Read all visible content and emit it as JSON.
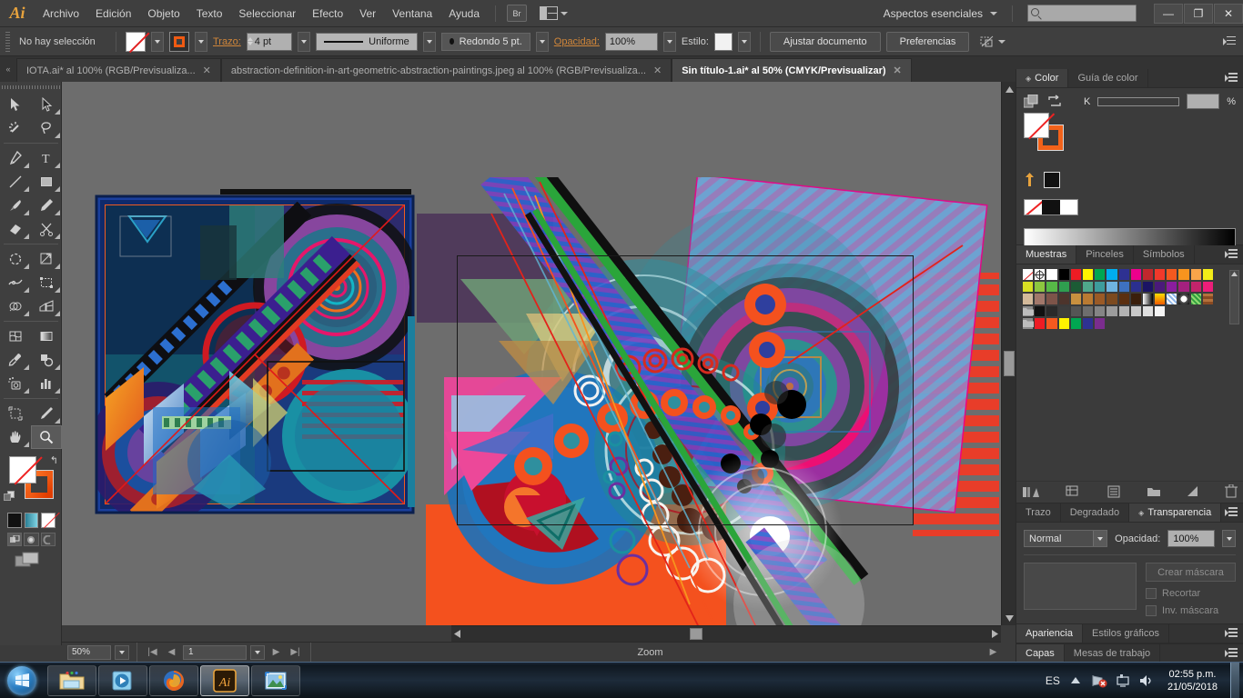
{
  "app": {
    "name": "Adobe Illustrator",
    "logo": "Ai"
  },
  "menubar": {
    "items": [
      "Archivo",
      "Edición",
      "Objeto",
      "Texto",
      "Seleccionar",
      "Efecto",
      "Ver",
      "Ventana",
      "Ayuda"
    ],
    "bridge_label": "Br",
    "workspace": "Aspectos esenciales",
    "search_placeholder": "",
    "minimize": "—",
    "restore": "❐",
    "close": "✕"
  },
  "controlbar": {
    "selection_status": "No hay selección",
    "stroke_label": "Trazo:",
    "stroke_weight": "4 pt",
    "stroke_profile": "Uniforme",
    "brush_definition": "Redondo 5 pt.",
    "opacity_label": "Opacidad:",
    "opacity_value": "100%",
    "style_label": "Estilo:",
    "fit_document_button": "Ajustar documento",
    "preferences_button": "Preferencias"
  },
  "tabs": [
    {
      "title": "IOTA.ai* al 100% (RGB/Previsualiza...",
      "active": false,
      "close": "✕"
    },
    {
      "title": "abstraction-definition-in-art-geometric-abstraction-paintings.jpeg al 100% (RGB/Previsualiza...",
      "active": false,
      "close": "✕"
    },
    {
      "title": "Sin título-1.ai* al 50% (CMYK/Previsualizar)",
      "active": true,
      "close": "✕"
    }
  ],
  "tools": {
    "rows": [
      [
        {
          "name": "selection-tool",
          "label": "Selección"
        },
        {
          "name": "direct-selection-tool",
          "label": "Selección directa"
        }
      ],
      [
        {
          "name": "magic-wand-tool",
          "label": "Varita mágica"
        },
        {
          "name": "lasso-tool",
          "label": "Lazo"
        }
      ],
      [
        {
          "name": "pen-tool",
          "label": "Pluma"
        },
        {
          "name": "type-tool",
          "label": "Texto"
        }
      ],
      [
        {
          "name": "line-segment-tool",
          "label": "Segmento de línea"
        },
        {
          "name": "rectangle-tool",
          "label": "Rectángulo"
        }
      ],
      [
        {
          "name": "paintbrush-tool",
          "label": "Pincel"
        },
        {
          "name": "pencil-tool",
          "label": "Lápiz"
        }
      ],
      [
        {
          "name": "blob-brush-tool",
          "label": "Pincel de manchas"
        },
        {
          "name": "eraser-tool",
          "label": "Borrador / Tijeras"
        }
      ],
      [
        {
          "name": "rotate-tool",
          "label": "Rotar"
        },
        {
          "name": "scale-tool",
          "label": "Escala"
        }
      ],
      [
        {
          "name": "width-tool",
          "label": "Anchura"
        },
        {
          "name": "free-transform-tool",
          "label": "Transformación libre"
        }
      ],
      [
        {
          "name": "shape-builder-tool",
          "label": "Creador de formas"
        },
        {
          "name": "perspective-grid-tool",
          "label": "Cuadrícula de perspectiva"
        }
      ],
      [
        {
          "name": "mesh-tool",
          "label": "Malla"
        },
        {
          "name": "gradient-tool",
          "label": "Degradado"
        }
      ],
      [
        {
          "name": "eyedropper-tool",
          "label": "Cuentagotas"
        },
        {
          "name": "blend-tool",
          "label": "Fusión"
        }
      ],
      [
        {
          "name": "symbol-sprayer-tool",
          "label": "Rociar símbolos"
        },
        {
          "name": "column-graph-tool",
          "label": "Gráfica de columnas"
        }
      ],
      [
        {
          "name": "artboard-tool",
          "label": "Mesa de trabajo"
        },
        {
          "name": "slice-tool",
          "label": "Sector"
        }
      ],
      [
        {
          "name": "hand-tool",
          "label": "Mano"
        },
        {
          "name": "zoom-tool",
          "label": "Zoom",
          "selected": true
        }
      ]
    ],
    "fill_stroke": {
      "fill": "none",
      "stroke": "#f2621a",
      "swap_label": "↰"
    },
    "color_modes": [
      "color-solid",
      "gradient",
      "none"
    ],
    "draw_modes": [
      "draw-normal",
      "draw-behind",
      "draw-inside"
    ]
  },
  "statusbar": {
    "zoom_level": "50%",
    "page_number": "1",
    "tool_status": "Zoom"
  },
  "dock": {
    "color_panel": {
      "tabs": [
        {
          "label": "Color",
          "active": true
        },
        {
          "label": "Guía de color",
          "active": false
        }
      ],
      "channel_label": "K",
      "channel_value": "",
      "percent_sign": "%"
    },
    "swatches_panel": {
      "tabs": [
        {
          "label": "Muestras",
          "active": true
        },
        {
          "label": "Pinceles",
          "active": false
        },
        {
          "label": "Símbolos",
          "active": false
        }
      ],
      "rows": [
        [
          "none",
          "registration",
          "#ffffff",
          "#000000",
          "#ed1c24",
          "#fff200",
          "#00a651",
          "#00aeef",
          "#2e3192",
          "#ec008c",
          "#c1272d",
          "#f1392b",
          "#f4591f",
          "#f7941e",
          "#f9a54a",
          "#f3ec18"
        ],
        [
          "#d7df23",
          "#8dc63f",
          "#57b947",
          "#2f9e4f",
          "#1c5b35",
          "#4fa88b",
          "#3d9c9c",
          "#6fb4e0",
          "#3e71c0",
          "#2b2f8f",
          "#1b1464",
          "#4a1a7a",
          "#8a1d9e",
          "#a4207f",
          "#c3246b",
          "#ec1e79"
        ],
        [
          "#d3b99a",
          "#a1776a",
          "#7d5449",
          "#4d342c",
          "#c9903f",
          "#b97a32",
          "#9a5a26",
          "#7c4a1f",
          "#5b2f10",
          "#3a1f0c",
          "grad-bw",
          "grad-orange",
          "pattern-blue",
          "pattern-ball",
          "pattern-green",
          "pattern-brick"
        ],
        [
          "folder",
          "#111111",
          "#2a2a2a",
          "#3d3d3d",
          "#555555",
          "#6e6e6e",
          "#858585",
          "#9c9c9c",
          "#b3b3b3",
          "#c9c9c9",
          "#e0e0e0",
          "#f5f5f5"
        ],
        [
          "folder",
          "#ed1c24",
          "#f4591f",
          "#fff200",
          "#00a651",
          "#2e3192",
          "#7b2d8e"
        ]
      ]
    },
    "transparency_panel": {
      "tabs": [
        {
          "label": "Trazo",
          "active": false
        },
        {
          "label": "Degradado",
          "active": false
        },
        {
          "label": "Transparencia",
          "active": true
        }
      ],
      "blend_mode": "Normal",
      "opacity_label": "Opacidad:",
      "opacity_value": "100%",
      "make_mask_button": "Crear máscara",
      "clip_checkbox": "Recortar",
      "invert_mask_checkbox": "Inv. máscara"
    },
    "appearance_panel": {
      "tabs": [
        {
          "label": "Apariencia",
          "active": true
        },
        {
          "label": "Estilos gráficos",
          "active": false
        }
      ]
    },
    "layers_panel": {
      "tabs": [
        {
          "label": "Capas",
          "active": true
        },
        {
          "label": "Mesas de trabajo",
          "active": false
        }
      ]
    }
  },
  "taskbar": {
    "start_label": "Inicio",
    "apps": [
      {
        "name": "windows-explorer",
        "label": "Explorador de Windows",
        "active": false
      },
      {
        "name": "windows-media-player",
        "label": "Reproductor de Windows Media",
        "active": false
      },
      {
        "name": "firefox",
        "label": "Mozilla Firefox",
        "active": false
      },
      {
        "name": "adobe-illustrator",
        "label": "Adobe Illustrator",
        "active": true
      },
      {
        "name": "photo-viewer",
        "label": "Visualizador de fotos",
        "active": false
      }
    ],
    "language": "ES",
    "time": "02:55 p.m.",
    "date": "21/05/2018"
  }
}
